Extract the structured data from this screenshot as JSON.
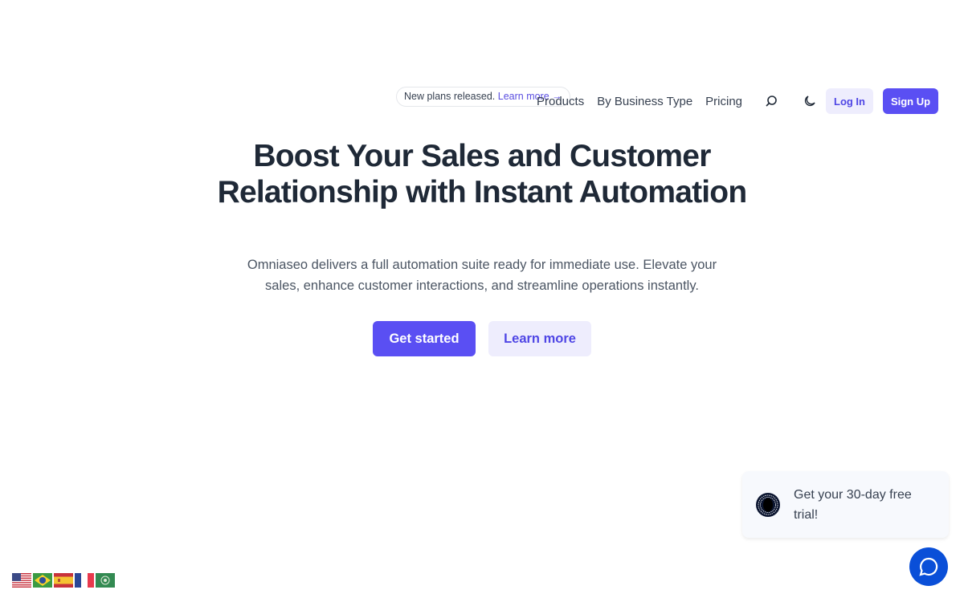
{
  "announcement": {
    "text": "New plans released.",
    "link": "Learn more →"
  },
  "nav": {
    "items": [
      "Products",
      "By Business Type",
      "Pricing"
    ],
    "login": "Log In",
    "signup": "Sign Up",
    "icons": [
      "search-icon",
      "moon-icon"
    ]
  },
  "hero": {
    "title_line1": "Boost Your Sales and Customer",
    "title_line2": "Relationship with Instant Automation",
    "subtitle": "Omniaseo delivers a full automation suite ready for immediate use. Elevate your sales, enhance customer interactions, and streamline operations instantly.",
    "primary_cta": "Get started",
    "secondary_cta": "Learn more"
  },
  "promo": {
    "text": "Get your 30-day free trial!"
  },
  "languages": [
    "English (US)",
    "Português (Brasil)",
    "Español",
    "Français",
    "العربية"
  ],
  "colors": {
    "accent": "#5a4ff3",
    "accent_light": "#eeedfd",
    "chat": "#0a4fd8"
  }
}
